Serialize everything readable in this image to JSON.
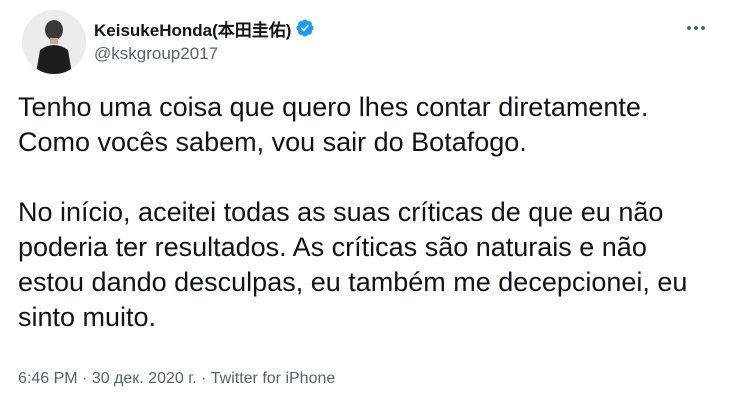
{
  "author": {
    "display_name": "KeisukeHonda(本田圭佑)",
    "handle": "@kskgroup2017",
    "verified": true
  },
  "tweet": {
    "paragraphs": [
      "Tenho uma coisa que quero lhes contar diretamente. Como vocês sabem, vou sair do Botafogo.",
      "No início, aceitei todas as suas críticas de que eu não poderia ter resultados. As críticas são naturais e não estou dando desculpas, eu também me decepcionei, eu sinto muito."
    ]
  },
  "meta": {
    "time": "6:46 PM",
    "separator": " · ",
    "date": "30 дек. 2020 г.",
    "source": "Twitter for iPhone"
  },
  "icons": {
    "verified": "verified-badge-icon",
    "more": "more-options-icon"
  },
  "colors": {
    "verified_blue": "#1d9bf0",
    "secondary_text": "#536471"
  }
}
